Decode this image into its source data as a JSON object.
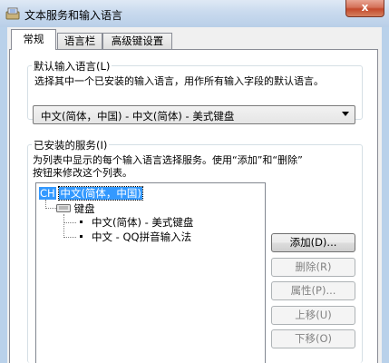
{
  "window": {
    "title": "文本服务和输入语言",
    "close_label": "x"
  },
  "tabs": [
    {
      "label": "常规"
    },
    {
      "label": "语言栏"
    },
    {
      "label": "高级键设置"
    }
  ],
  "default_input": {
    "group_label": "默认输入语言(L)",
    "description": "选择其中一个已安装的输入语言，用作所有输入字段的默认语言。",
    "selected": "中文(简体，中国) - 中文(简体) - 美式键盘"
  },
  "installed_services": {
    "group_label": "已安装的服务(I)",
    "description_line1": "为列表中显示的每个输入语言选择服务。使用“添加”和“删除”",
    "description_line2": "按钮来修改这个列表。",
    "tree": {
      "lang_badge": "CH",
      "language": "中文(简体，中国)",
      "category": "键盘",
      "items": [
        "中文(简体) - 美式键盘",
        "中文 - QQ拼音输入法"
      ]
    }
  },
  "buttons": {
    "add": "添加(D)...",
    "remove": "删除(R)",
    "properties": "属性(P)...",
    "move_up": "上移(U)",
    "move_down": "下移(O)"
  }
}
